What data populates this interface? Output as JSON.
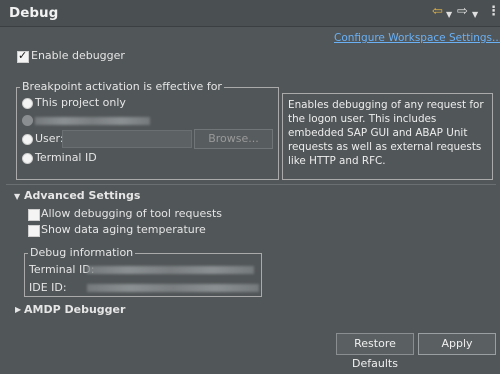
{
  "header": {
    "title": "Debug",
    "icons": [
      "back-arrow-icon",
      "dropdown-icon",
      "forward-arrow-icon",
      "dropdown-icon",
      "vertical-ellipsis-icon"
    ],
    "back_color": "#e8b84a"
  },
  "config_link": "Configure Workspace Settings...",
  "enable_debugger": {
    "label": "Enable debugger",
    "checked": true
  },
  "breakpoint": {
    "group_title": "Breakpoint activation is effective for",
    "options": [
      {
        "label": "This project only",
        "selected": false
      },
      {
        "label": "",
        "selected": false
      },
      {
        "label": "User:",
        "selected": false
      },
      {
        "label": "Terminal ID",
        "selected": false
      }
    ],
    "user_value": "",
    "browse_label": "Browse..."
  },
  "info_text": "Enables debugging of any request for the logon user. This includes embedded SAP GUI and ABAP Unit requests as well as external requests like HTTP and RFC.",
  "advanced": {
    "title": "Advanced Settings",
    "expanded": true,
    "checkboxes": [
      {
        "label": "Allow debugging of tool requests",
        "checked": false
      },
      {
        "label": "Show data aging temperature",
        "checked": false
      }
    ],
    "debug_info": {
      "title": "Debug information",
      "terminal_label": "Terminal ID:",
      "ide_label": "IDE ID:"
    }
  },
  "amdp": {
    "title": "AMDP Debugger",
    "expanded": false
  },
  "buttons": {
    "restore": "Restore Defaults",
    "apply": "Apply"
  },
  "colors": {
    "background": "#515658",
    "link": "#6ab0f5"
  }
}
